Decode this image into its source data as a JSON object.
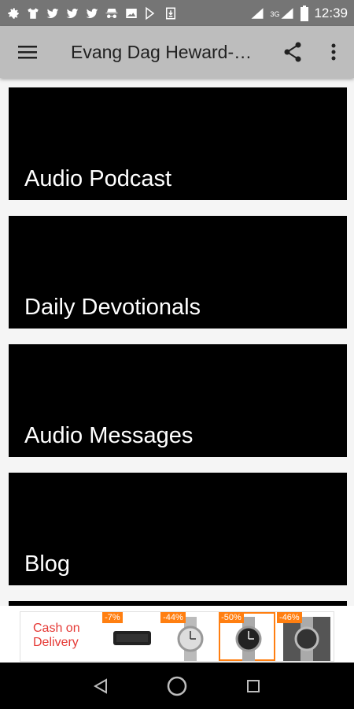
{
  "status_bar": {
    "time": "12:39",
    "network": "3G",
    "icons": [
      "settings-icon",
      "tshirt-icon",
      "twitter-icon",
      "twitter-icon",
      "twitter-icon",
      "incognito-icon",
      "image-icon",
      "play-store-icon",
      "download-icon",
      "wifi-icon",
      "signal-icon",
      "battery-icon"
    ]
  },
  "app_bar": {
    "title": "Evang Dag Heward-…",
    "menu_icon": "hamburger-menu-icon",
    "share_icon": "share-icon",
    "more_icon": "more-vert-icon"
  },
  "cards": [
    {
      "label": "Audio Podcast"
    },
    {
      "label": "Daily Devotionals"
    },
    {
      "label": "Audio Messages"
    },
    {
      "label": "Blog"
    }
  ],
  "ad": {
    "cod_line1": "Cash on",
    "cod_line2": "Delivery",
    "items": [
      {
        "badge": "-7%",
        "product": "speaker"
      },
      {
        "badge": "-44%",
        "product": "watch"
      },
      {
        "badge": "-50%",
        "product": "watch"
      },
      {
        "badge": "-46%",
        "product": "watch"
      }
    ]
  },
  "nav_bar": {
    "back_icon": "back-triangle-icon",
    "home_icon": "home-circle-icon",
    "recents_icon": "recents-square-icon"
  },
  "colors": {
    "status_bar": "#757575",
    "app_bar": "#bdbdbd",
    "card": "#000000",
    "ad_accent": "#ff7f11",
    "ad_text": "#e53935"
  }
}
